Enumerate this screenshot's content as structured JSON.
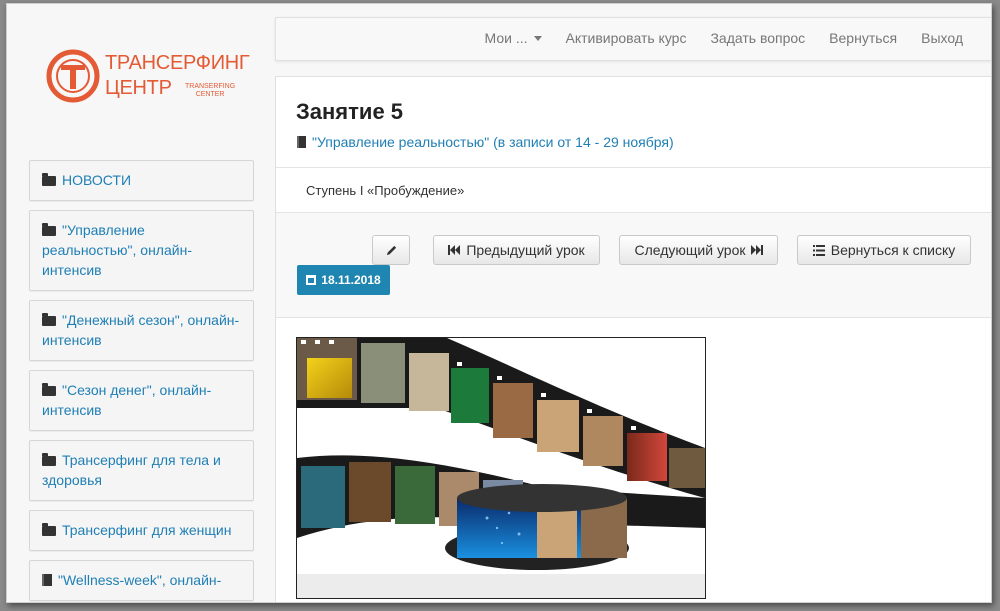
{
  "logo": {
    "line1": "ТРАНСЕРФИНГ",
    "line2": "ЦЕНТР",
    "sub": "TRANSERFING\nCENTER",
    "brand_color": "#e45a34"
  },
  "nav": {
    "items": [
      {
        "label": "Мои ...",
        "dropdown": true
      },
      {
        "label": "Активировать курс"
      },
      {
        "label": "Задать вопрос"
      },
      {
        "label": "Вернуться"
      },
      {
        "label": "Выход"
      }
    ]
  },
  "sidebar": {
    "items": [
      {
        "label": "НОВОСТИ",
        "icon": "folder-icon"
      },
      {
        "label": "\"Управление реальностью\", онлайн-интенсив",
        "icon": "folder-icon"
      },
      {
        "label": "\"Денежный сезон\", онлайн-интенсив",
        "icon": "folder-icon"
      },
      {
        "label": "\"Сезон денег\", онлайн-интенсив",
        "icon": "folder-icon"
      },
      {
        "label": "Трансерфинг для тела и здоровья",
        "icon": "folder-icon"
      },
      {
        "label": "Трансерфинг для женщин",
        "icon": "folder-icon"
      },
      {
        "label": "\"Wellness-week\", онлайн-",
        "icon": "book-icon"
      }
    ]
  },
  "lesson": {
    "title": "Занятие 5",
    "course_link": "\"Управление реальностью\" (в записи от 14 - 29 ноября)",
    "step": "Ступень I «Пробуждение»",
    "buttons": {
      "prev": "Предыдущий урок",
      "next": "Следующий урок",
      "list": "Вернуться к списку"
    },
    "date": "18.11.2018"
  },
  "colors": {
    "link": "#1f7fb5",
    "badge": "#1e86b0"
  }
}
